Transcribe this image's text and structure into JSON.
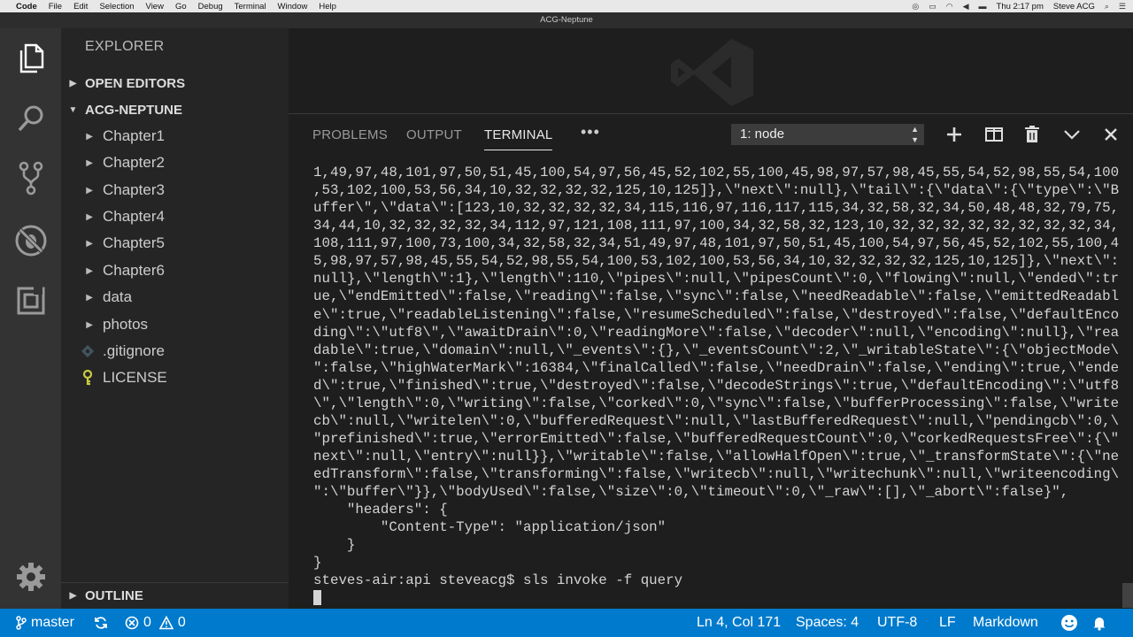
{
  "menubar": {
    "items": [
      "Code",
      "File",
      "Edit",
      "Selection",
      "View",
      "Go",
      "Debug",
      "Terminal",
      "Window",
      "Help"
    ],
    "clock": "Thu 2:17 pm",
    "user": "Steve ACG"
  },
  "window": {
    "title": "ACG-Neptune"
  },
  "sidebar": {
    "title": "EXPLORER",
    "open_editors": "OPEN EDITORS",
    "project": "ACG-NEPTUNE",
    "items": [
      {
        "label": "Chapter1",
        "kind": "folder"
      },
      {
        "label": "Chapter2",
        "kind": "folder"
      },
      {
        "label": "Chapter3",
        "kind": "folder"
      },
      {
        "label": "Chapter4",
        "kind": "folder"
      },
      {
        "label": "Chapter5",
        "kind": "folder"
      },
      {
        "label": "Chapter6",
        "kind": "folder"
      },
      {
        "label": "data",
        "kind": "folder"
      },
      {
        "label": "photos",
        "kind": "folder"
      },
      {
        "label": ".gitignore",
        "kind": "file",
        "icon": "git-file-icon"
      },
      {
        "label": "LICENSE",
        "kind": "file",
        "icon": "license-key-icon"
      }
    ],
    "outline": "OUTLINE"
  },
  "panel": {
    "tabs": [
      {
        "label": "PROBLEMS",
        "active": false
      },
      {
        "label": "OUTPUT",
        "active": false
      },
      {
        "label": "TERMINAL",
        "active": true
      }
    ],
    "more": "•••",
    "terminal_select": "1: node"
  },
  "terminal": {
    "lines": [
      "1,49,97,48,101,97,50,51,45,100,54,97,56,45,52,102,55,100,45,98,97,57,98,45,55,54,52,98,55,54,100",
      ",53,102,100,53,56,34,10,32,32,32,32,125,10,125]},\\\"next\\\":null},\\\"tail\\\":{\\\"data\\\":{\\\"type\\\":\\\"B",
      "uffer\\\",\\\"data\\\":[123,10,32,32,32,32,34,115,116,97,116,117,115,34,32,58,32,34,50,48,48,32,79,75,",
      "34,44,10,32,32,32,32,34,112,97,121,108,111,97,100,34,32,58,32,123,10,32,32,32,32,32,32,32,32,34,",
      "108,111,97,100,73,100,34,32,58,32,34,51,49,97,48,101,97,50,51,45,100,54,97,56,45,52,102,55,100,4",
      "5,98,97,57,98,45,55,54,52,98,55,54,100,53,102,100,53,56,34,10,32,32,32,32,125,10,125]},\\\"next\\\":",
      "null},\\\"length\\\":1},\\\"length\\\":110,\\\"pipes\\\":null,\\\"pipesCount\\\":0,\\\"flowing\\\":null,\\\"ended\\\":tr",
      "ue,\\\"endEmitted\\\":false,\\\"reading\\\":false,\\\"sync\\\":false,\\\"needReadable\\\":false,\\\"emittedReadabl",
      "e\\\":true,\\\"readableListening\\\":false,\\\"resumeScheduled\\\":false,\\\"destroyed\\\":false,\\\"defaultEnco",
      "ding\\\":\\\"utf8\\\",\\\"awaitDrain\\\":0,\\\"readingMore\\\":false,\\\"decoder\\\":null,\\\"encoding\\\":null},\\\"rea",
      "dable\\\":true,\\\"domain\\\":null,\\\"_events\\\":{},\\\"_eventsCount\\\":2,\\\"_writableState\\\":{\\\"objectMode\\",
      "\":false,\\\"highWaterMark\\\":16384,\\\"finalCalled\\\":false,\\\"needDrain\\\":false,\\\"ending\\\":true,\\\"ende",
      "d\\\":true,\\\"finished\\\":true,\\\"destroyed\\\":false,\\\"decodeStrings\\\":true,\\\"defaultEncoding\\\":\\\"utf8",
      "\\\",\\\"length\\\":0,\\\"writing\\\":false,\\\"corked\\\":0,\\\"sync\\\":false,\\\"bufferProcessing\\\":false,\\\"write",
      "cb\\\":null,\\\"writelen\\\":0,\\\"bufferedRequest\\\":null,\\\"lastBufferedRequest\\\":null,\\\"pendingcb\\\":0,\\",
      "\"prefinished\\\":true,\\\"errorEmitted\\\":false,\\\"bufferedRequestCount\\\":0,\\\"corkedRequestsFree\\\":{\\\"",
      "next\\\":null,\\\"entry\\\":null}},\\\"writable\\\":false,\\\"allowHalfOpen\\\":true,\\\"_transformState\\\":{\\\"ne",
      "edTransform\\\":false,\\\"transforming\\\":false,\\\"writecb\\\":null,\\\"writechunk\\\":null,\\\"writeencoding\\",
      "\":\\\"buffer\\\"}},\\\"bodyUsed\\\":false,\\\"size\\\":0,\\\"timeout\\\":0,\\\"_raw\\\":[],\\\"_abort\\\":false}\",",
      "    \"headers\": {",
      "        \"Content-Type\": \"application/json\"",
      "    }",
      "}",
      "steves-air:api steveacg$ sls invoke -f query"
    ]
  },
  "status": {
    "branch": "master",
    "errors": "0",
    "warnings": "0",
    "position": "Ln 4, Col 171",
    "spaces": "Spaces: 4",
    "encoding": "UTF-8",
    "eol": "LF",
    "language": "Markdown"
  }
}
